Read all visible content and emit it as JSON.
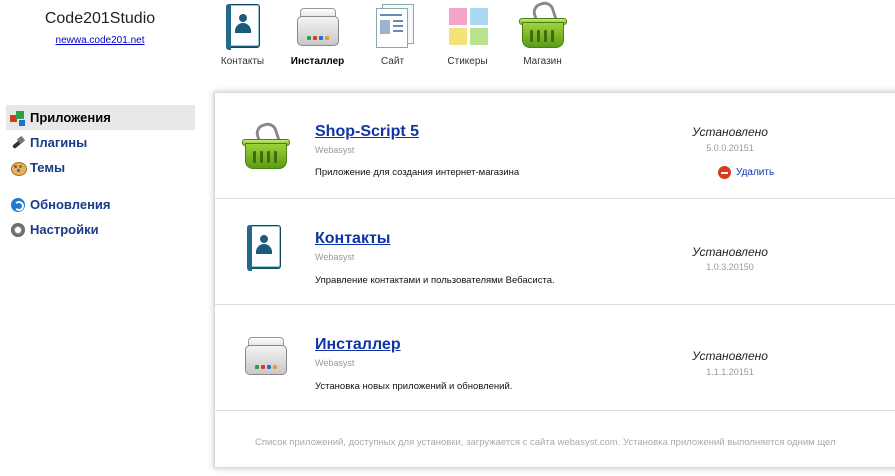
{
  "brand": {
    "name": "Code201Studio",
    "link": "newwa.code201.net"
  },
  "appbar": [
    {
      "label": "Контакты",
      "icon": "contacts-book-icon",
      "active": false
    },
    {
      "label": "Инсталлер",
      "icon": "installer-drive-icon",
      "active": true
    },
    {
      "label": "Сайт",
      "icon": "site-pages-icon",
      "active": false
    },
    {
      "label": "Стикеры",
      "icon": "stickers-icon",
      "active": false
    },
    {
      "label": "Магазин",
      "icon": "shop-basket-icon",
      "active": false
    }
  ],
  "sidebar": {
    "items": [
      {
        "label": "Приложения",
        "icon": "apps-icon",
        "active": true
      },
      {
        "label": "Плагины",
        "icon": "plug-icon",
        "active": false
      },
      {
        "label": "Темы",
        "icon": "palette-icon",
        "active": false
      },
      {
        "label": "Обновления",
        "icon": "update-icon",
        "active": false
      },
      {
        "label": "Настройки",
        "icon": "gear-icon",
        "active": false
      }
    ]
  },
  "apps": [
    {
      "title": "Shop-Script 5",
      "vendor": "Webasyst",
      "description": "Приложение для создания интернет-магазина",
      "status": "Установлено",
      "version": "5.0.0.20151",
      "delete_label": "Удалить",
      "icon": "shop-basket-icon"
    },
    {
      "title": "Контакты",
      "vendor": "Webasyst",
      "description": "Управление контактами и пользователями Вебасиста.",
      "status": "Установлено",
      "version": "1.0.3.20150",
      "icon": "contacts-book-icon"
    },
    {
      "title": "Инсталлер",
      "vendor": "Webasyst",
      "description": "Установка новых приложений и обновлений.",
      "status": "Установлено",
      "version": "1.1.1.20151",
      "icon": "installer-drive-icon"
    }
  ],
  "footer_note": "Список приложений, доступных для установки, загружается с сайта webasyst.com. Установка приложений выполняется одним щел",
  "colors": {
    "link": "#1034a6",
    "basket_green": "#7cbb2b",
    "delete_red": "#d93a1e",
    "book_blue": "#1c5d7e"
  }
}
